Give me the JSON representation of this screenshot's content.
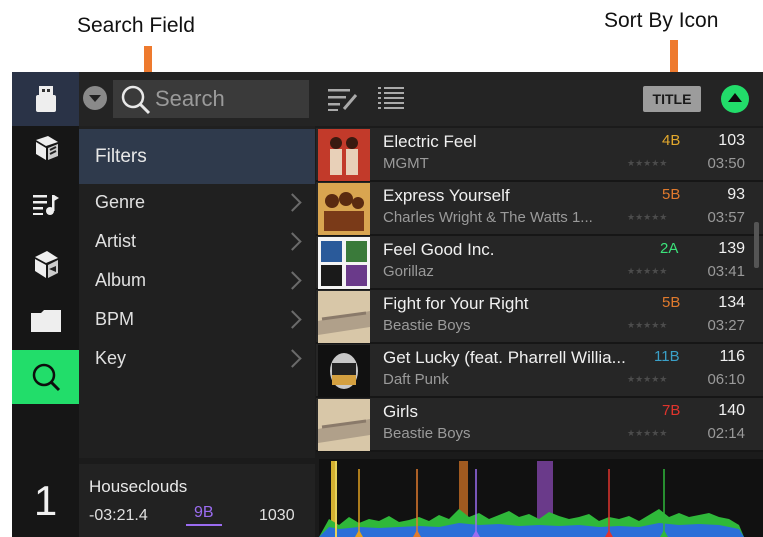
{
  "callouts": {
    "search_field": "Search Field",
    "sort_by_icon": "Sort By Icon"
  },
  "colors": {
    "accent_green": "#22dd6a",
    "callout_arrow": "#ee7a2e",
    "filters_highlight": "#2f3a4c",
    "key_purple": "#9b6cf0"
  },
  "nav": {
    "items": [
      {
        "icon": "usb-drive-icon"
      },
      {
        "icon": "crates-icon"
      },
      {
        "icon": "playlist-icon"
      },
      {
        "icon": "prepare-icon"
      },
      {
        "icon": "folder-icon"
      },
      {
        "icon": "search-icon",
        "active": true
      }
    ]
  },
  "toolbar": {
    "search_placeholder": "Search",
    "sort_label": "TITLE",
    "edit_icon": "edit-list-icon",
    "list_icon": "list-view-icon"
  },
  "filters": {
    "title": "Filters",
    "items": [
      "Genre",
      "Artist",
      "Album",
      "BPM",
      "Key"
    ]
  },
  "tracks": [
    {
      "title": "Electric Feel",
      "artist": "MGMT",
      "key": "4B",
      "key_color": "#e2a82d",
      "bpm": "103",
      "time": "03:50",
      "stars": "★★★★★"
    },
    {
      "title": "Express Yourself",
      "artist": "Charles Wright & The Watts 1...",
      "key": "5B",
      "key_color": "#e07a2d",
      "bpm": "93",
      "time": "03:57",
      "stars": "★★★★★"
    },
    {
      "title": "Feel Good Inc.",
      "artist": "Gorillaz",
      "key": "2A",
      "key_color": "#3be27a",
      "bpm": "139",
      "time": "03:41",
      "stars": "★★★★★"
    },
    {
      "title": "Fight for Your Right",
      "artist": "Beastie Boys",
      "key": "5B",
      "key_color": "#e07a2d",
      "bpm": "134",
      "time": "03:27",
      "stars": "★★★★★"
    },
    {
      "title": "Get Lucky (feat. Pharrell Willia...",
      "artist": "Daft Punk",
      "key": "11B",
      "key_color": "#3aa0c8",
      "bpm": "116",
      "time": "06:10",
      "stars": "★★★★★"
    },
    {
      "title": "Girls",
      "artist": "Beastie Boys",
      "key": "7B",
      "key_color": "#e0342d",
      "bpm": "140",
      "time": "02:14",
      "stars": "★★★★★"
    }
  ],
  "deck": {
    "number": "1",
    "track": "Houseclouds",
    "time": "-03:21.4",
    "key": "9B",
    "bpm": "1030"
  }
}
